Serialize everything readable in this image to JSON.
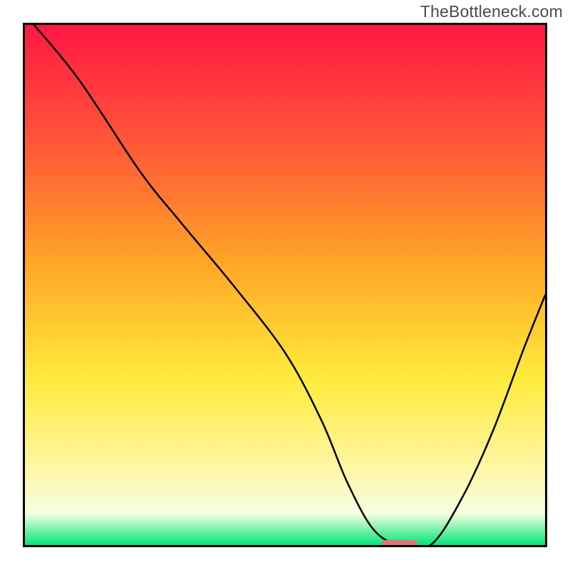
{
  "watermark": "TheBottleneck.com",
  "gradient_colors": {
    "top": "#ff1744",
    "mid1": "#ff5a36",
    "mid2": "#ffa726",
    "mid3": "#ffeb3b",
    "mid4": "#fff59d",
    "mid5": "#f4ffe0",
    "bottom": "#00e676"
  },
  "chart_data": {
    "type": "line",
    "title": "",
    "xlabel": "",
    "ylabel": "",
    "xlim": [
      0,
      100
    ],
    "ylim": [
      0,
      100
    ],
    "series": [
      {
        "name": "bottleneck-curve",
        "x": [
          0,
          10,
          22,
          30,
          40,
          50,
          57,
          62,
          67,
          72,
          78,
          84,
          90,
          96,
          100
        ],
        "values": [
          102,
          90,
          72,
          62,
          50,
          37,
          24,
          12,
          3,
          0,
          0,
          9,
          22,
          38,
          48
        ]
      }
    ],
    "marker": {
      "name": "optimal-zone",
      "x_center": 72,
      "y": 0,
      "width": 7,
      "color": "#e57373"
    }
  }
}
